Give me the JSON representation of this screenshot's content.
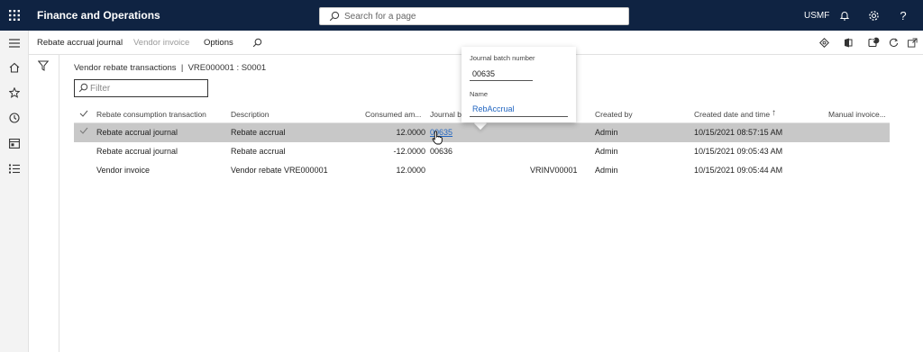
{
  "topbar": {
    "app_title": "Finance and Operations",
    "search_placeholder": "Search for a page",
    "company": "USMF"
  },
  "action_pane": {
    "items": [
      "Rebate accrual journal",
      "Vendor invoice",
      "Options"
    ]
  },
  "content": {
    "breadcrumb": "Vendor rebate transactions  |  VRE000001 : S0001",
    "filter_placeholder": "Filter"
  },
  "grid": {
    "columns": [
      "Rebate consumption transaction",
      "Description",
      "Consumed am...",
      "Journal ba",
      "Created by",
      "Created date and time",
      "Manual invoice..."
    ],
    "sort_indicator": "↑",
    "rows": [
      {
        "transaction": "Rebate accrual journal",
        "description": "Rebate accrual",
        "consumed": "12.0000",
        "journal": "00635",
        "invoice": "",
        "created_by": "Admin",
        "created": "10/15/2021 08:57:15 AM",
        "selected": true
      },
      {
        "transaction": "Rebate accrual journal",
        "description": "Rebate accrual",
        "consumed": "-12.0000",
        "journal": "00636",
        "invoice": "",
        "created_by": "Admin",
        "created": "10/15/2021 09:05:43 AM",
        "selected": false
      },
      {
        "transaction": "Vendor invoice",
        "description": "Vendor rebate VRE000001",
        "consumed": "12.0000",
        "journal": "",
        "invoice": "VRINV00001",
        "created_by": "Admin",
        "created": "10/15/2021 09:05:44 AM",
        "selected": false
      }
    ]
  },
  "popup": {
    "batch_label": "Journal batch number",
    "batch_value": "00635",
    "name_label": "Name",
    "name_value": "RebAccrual"
  },
  "badges": {
    "notifications_count": "0"
  },
  "colors": {
    "nav_bar": "#0f2342",
    "selected_row": "#c8c8c8",
    "link": "#2266c1"
  }
}
